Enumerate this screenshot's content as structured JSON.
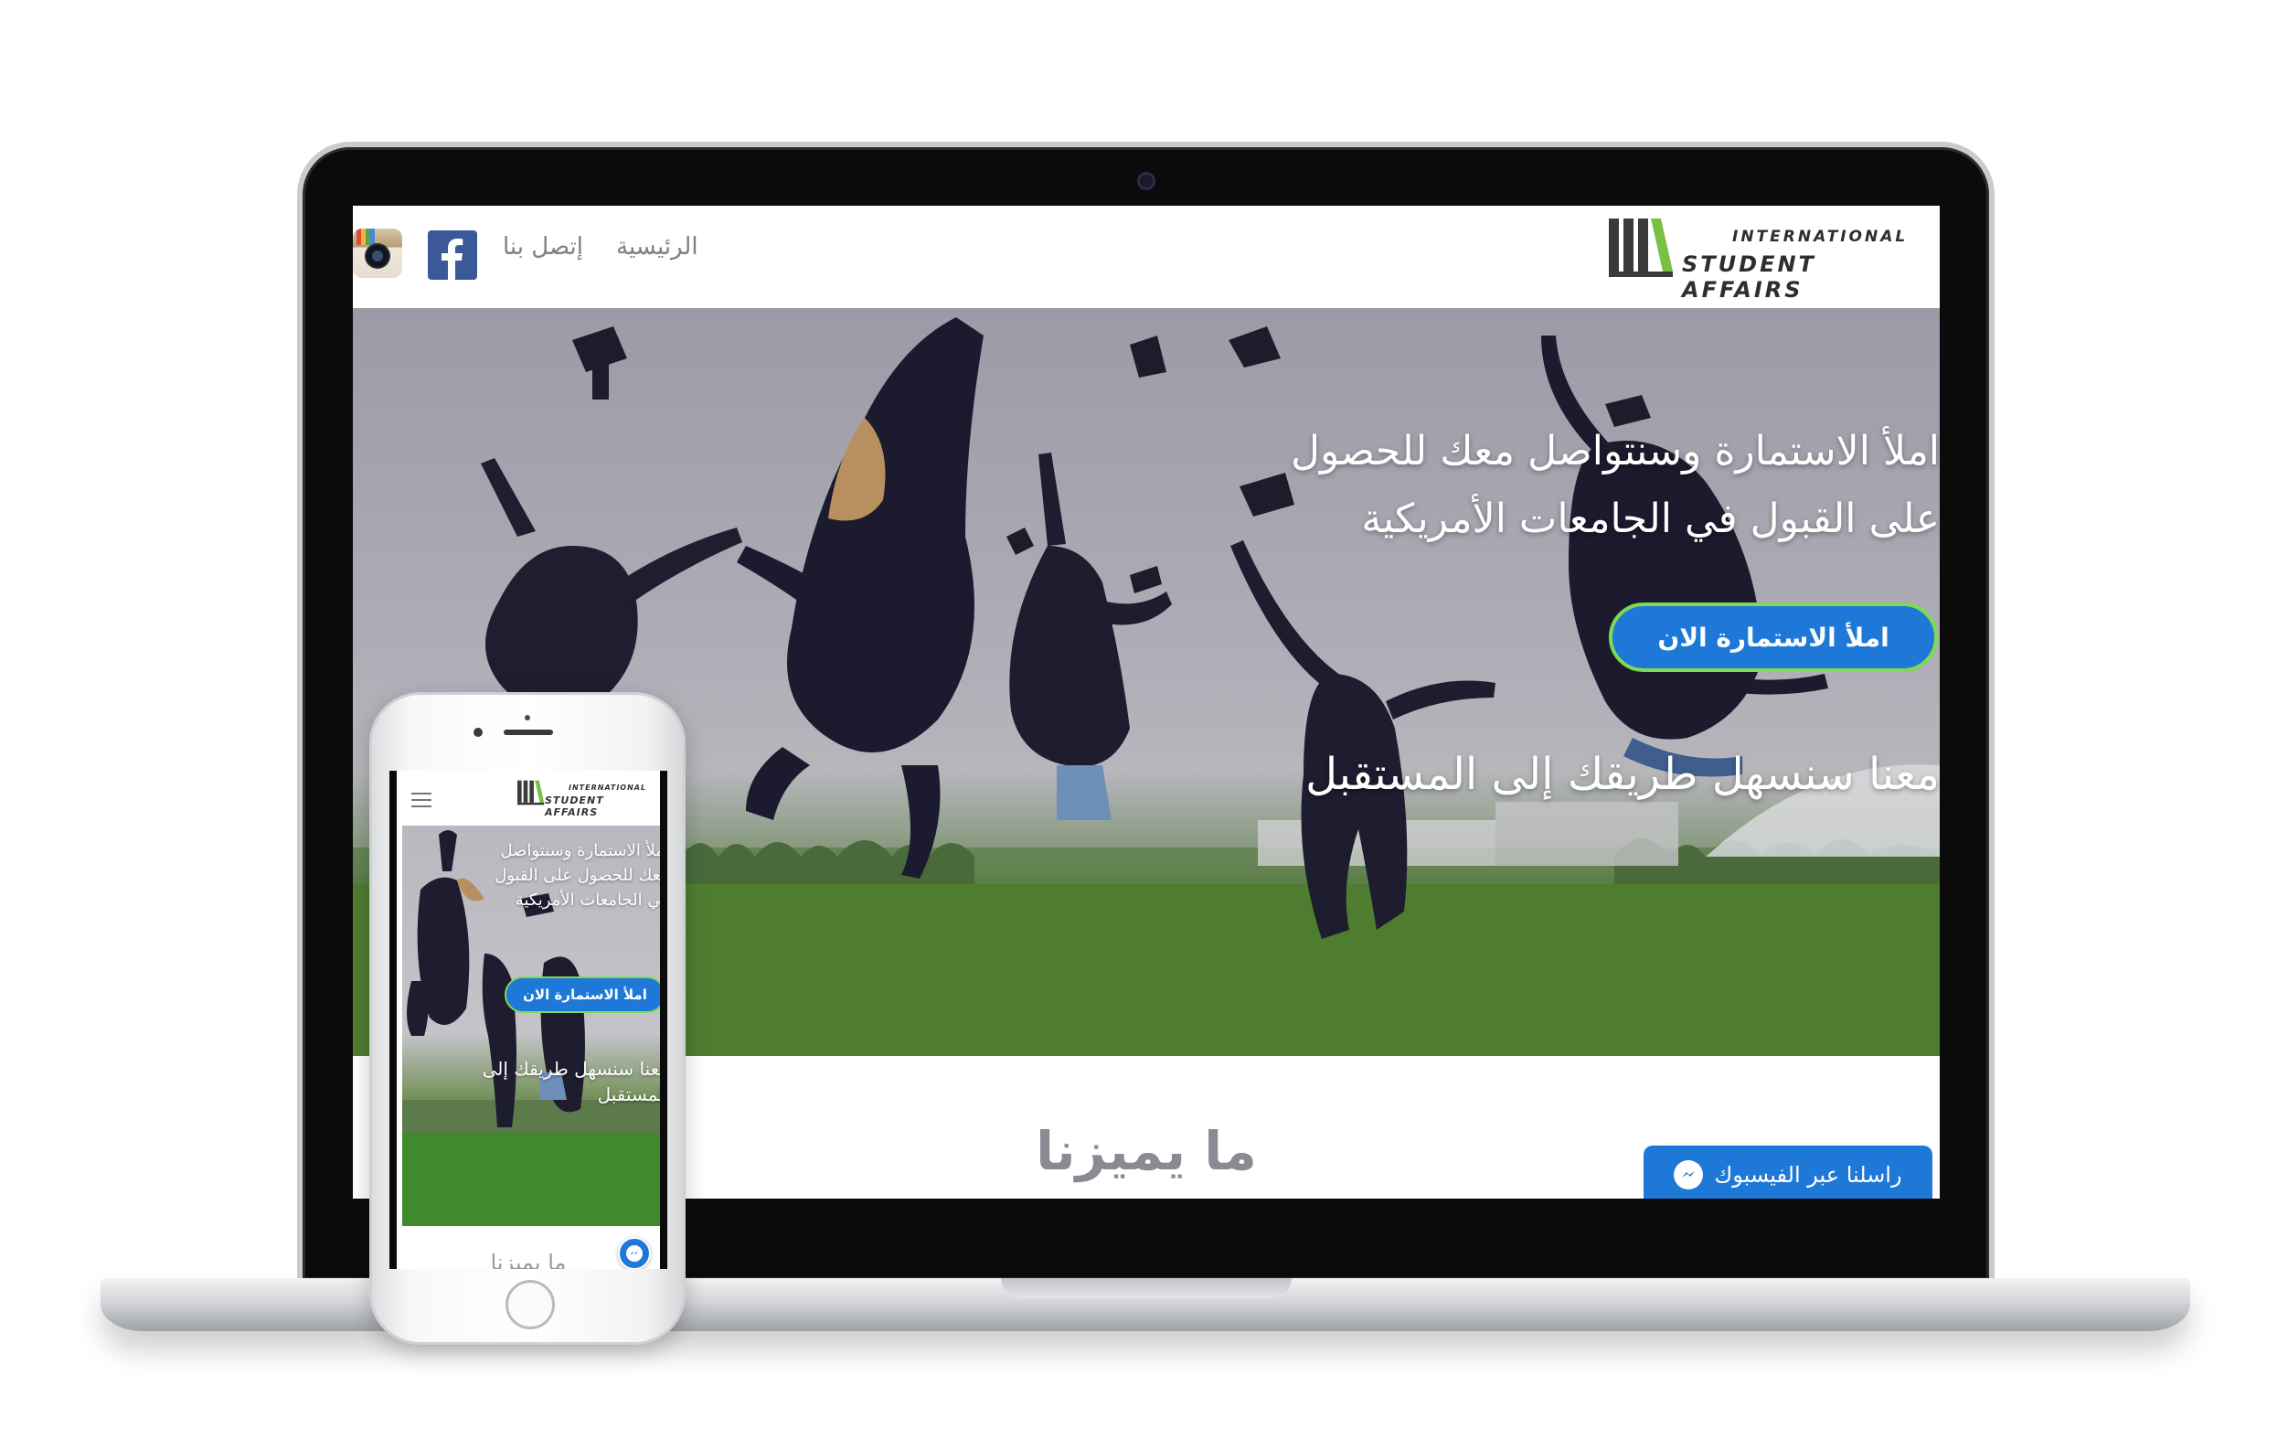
{
  "site": {
    "logo": {
      "line1": "INTERNATIONAL",
      "line2": "STUDENT AFFAIRS"
    },
    "nav": {
      "home": "الرئيسية",
      "contact": "إتصل بنا",
      "facebook_icon": "facebook-icon",
      "instagram_icon": "instagram-icon"
    },
    "hero": {
      "headline_line1": "املأ الاستمارة وسنتواصل معك للحصول",
      "headline_line2": "على القبول في الجامعات الأمريكية",
      "cta": "املأ الاستمارة الان",
      "tagline": "معنا سنسهل طريقك إلى المستقبل"
    },
    "section_title": "ما يميزنا",
    "messenger": {
      "label": "راسلنا عبر الفيسبوك",
      "icon": "messenger-icon"
    }
  },
  "mobile": {
    "logo": {
      "line1": "INTERNATIONAL",
      "line2": "STUDENT AFFAIRS"
    },
    "hero": {
      "headline_line1": "املأ الاستمارة وسنتواصل",
      "headline_line2": "معك للحصول على القبول",
      "headline_line3": "في الجامعات الأمريكية",
      "cta": "املأ الاستمارة الان",
      "tagline_line1": "معنا سنسهل طريقك إلى",
      "tagline_line2": "المستقبل"
    },
    "section_title": "ما يميزنا"
  },
  "colors": {
    "accent": "#1e78d8",
    "cta_border": "#7ed957",
    "facebook": "#3b5898",
    "logo_green": "#7ac143"
  }
}
